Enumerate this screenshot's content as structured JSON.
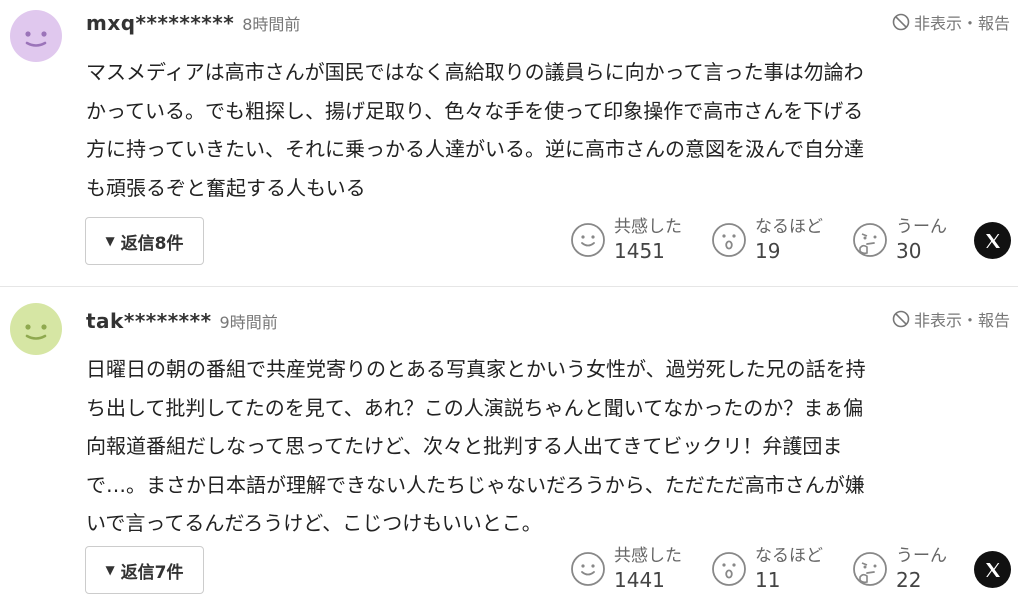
{
  "comments": [
    {
      "username": "mxq*********",
      "time": "8時間前",
      "report_label": "非表示・報告",
      "body": "マスメディアは高市さんが国民ではなく高給取りの議員らに向かって言った事は勿論わ\nかっている。でも粗探し、揚げ足取り、色々な手を使って印象操作で高市さんを下げる\n方に持っていきたい、それに乗っかる人達がいる。逆に高市さんの意図を汲んで自分達\nも頑張るぞと奮起する人もいる",
      "reply_label": "返信8件",
      "avatar_color": "#e0c8ee",
      "reactions": [
        {
          "label": "共感した",
          "count": "1451"
        },
        {
          "label": "なるほど",
          "count": "19"
        },
        {
          "label": "うーん",
          "count": "30"
        }
      ]
    },
    {
      "username": "tak********",
      "time": "9時間前",
      "report_label": "非表示・報告",
      "body": "日曜日の朝の番組で共産党寄りのとある写真家とかいう女性が、過労死した兄の話を持\nち出して批判してたのを見て、あれ？この人演説ちゃんと聞いてなかったのか？まぁ偏\n向報道番組だしなって思ってたけど、次々と批判する人出てきてビックリ！弁護団ま\nで…。まさか日本語が理解できない人たちじゃないだろうから、ただただ高市さんが嫌\nいで言ってるんだろうけど、こじつけもいいとこ。",
      "reply_label": "返信7件",
      "avatar_color": "#d6e6a4",
      "reactions": [
        {
          "label": "共感した",
          "count": "1441"
        },
        {
          "label": "なるほど",
          "count": "11"
        },
        {
          "label": "うーん",
          "count": "22"
        }
      ]
    }
  ],
  "icons": {
    "hide": "prohibit-icon",
    "reply_toggle": "triangle-down-icon",
    "reaction_1": "smile-face-icon",
    "reaction_2": "surprised-face-icon",
    "reaction_3": "thinking-face-icon",
    "share": "x-logo-icon"
  }
}
